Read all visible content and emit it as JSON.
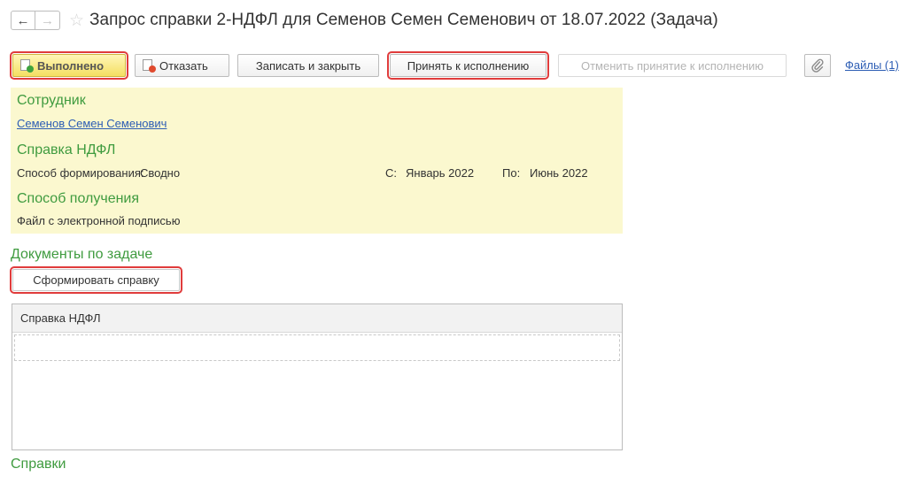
{
  "window": {
    "title": "Запрос справки 2-НДФЛ для Семенов Семен Семенович от 18.07.2022 (Задача)",
    "nav_back": "←",
    "nav_forward": "→",
    "favorite_icon": "☆"
  },
  "toolbar": {
    "done_label": "Выполнено",
    "refuse_label": "Отказать",
    "save_close_label": "Записать и закрыть",
    "accept_label": "Принять к исполнению",
    "cancel_accept_label": "Отменить принятие к исполнению",
    "clip_icon": "paperclip-icon",
    "files_label": "Файлы (1)"
  },
  "employee": {
    "section_title": "Сотрудник",
    "name": "Семенов Семен Семенович"
  },
  "ndfl": {
    "section_title": "Справка НДФЛ",
    "method_label": "Способ формирования:",
    "method_value": "Сводно",
    "from_label": "С:",
    "from_value": "Январь 2022",
    "to_label": "По:",
    "to_value": "Июнь 2022"
  },
  "receipt": {
    "section_title": "Способ получения",
    "value": "Файл с электронной подписью"
  },
  "documents": {
    "section_title": "Документы по задаче",
    "make_button_label": "Сформировать справку",
    "table": {
      "columns": [
        "Справка НДФЛ"
      ],
      "rows": []
    }
  },
  "certificates": {
    "section_title": "Справки"
  },
  "colors": {
    "section_green": "#3f9b3f",
    "panel_yellow": "#fbf8cf",
    "highlight_red": "#e03c3c",
    "link_blue": "#2c5db4"
  }
}
